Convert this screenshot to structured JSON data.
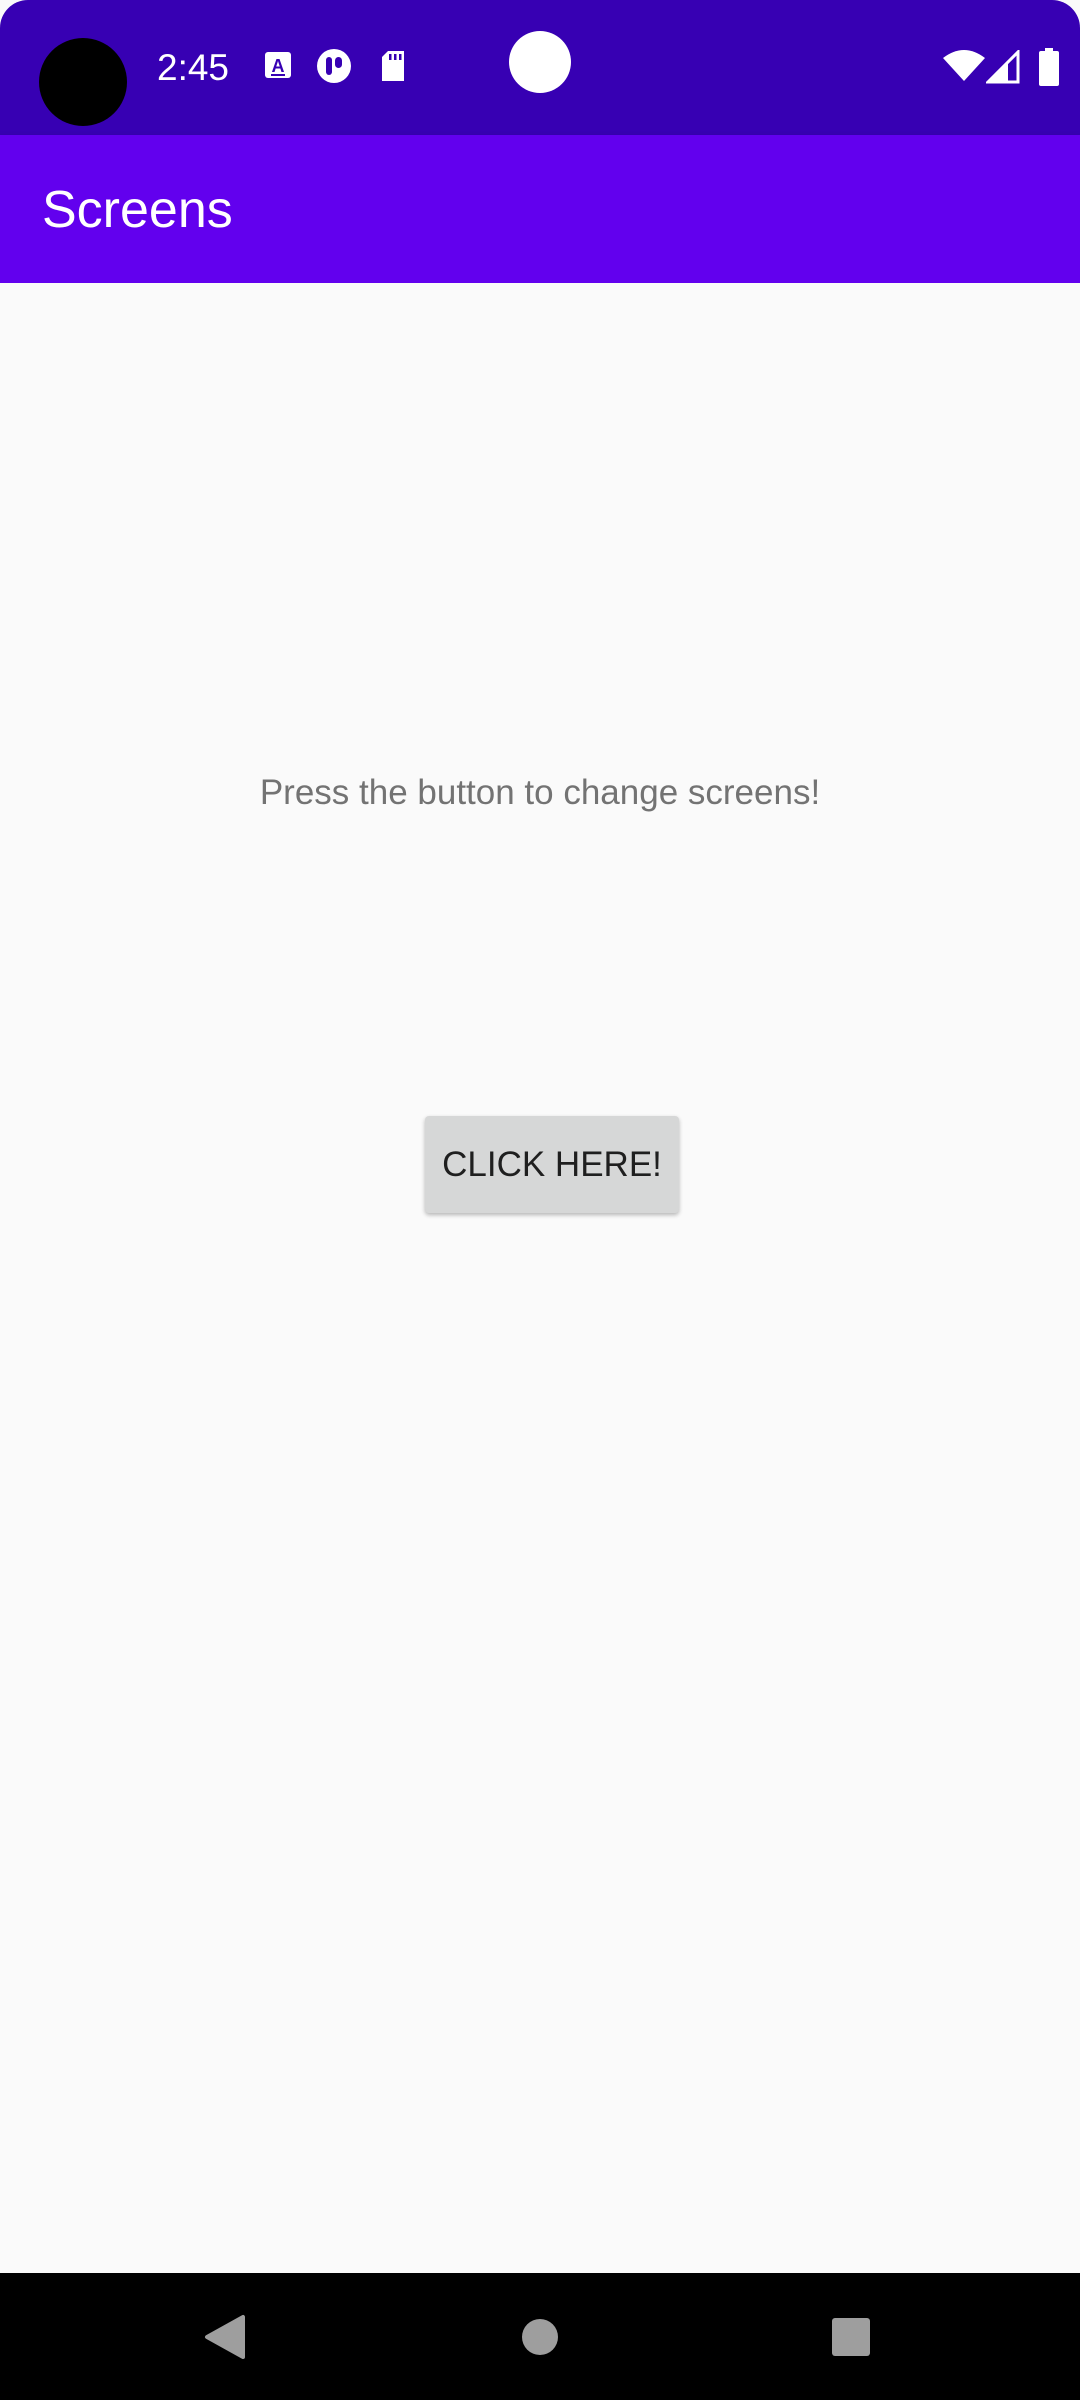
{
  "status_bar": {
    "time": "2:45",
    "background_color": "#3700b3",
    "notification_icons": [
      "accessibility-text-icon",
      "app-notification-icon",
      "sd-card-icon"
    ],
    "system_icons": [
      "wifi-icon",
      "cell-signal-icon",
      "battery-icon"
    ]
  },
  "app_bar": {
    "title": "Screens",
    "background_color": "#6200ee"
  },
  "main": {
    "prompt": "Press the button to change screens!",
    "button_label": "CLICK HERE!"
  },
  "nav_bar": {
    "buttons": [
      "back-icon",
      "home-icon",
      "recents-icon"
    ]
  }
}
